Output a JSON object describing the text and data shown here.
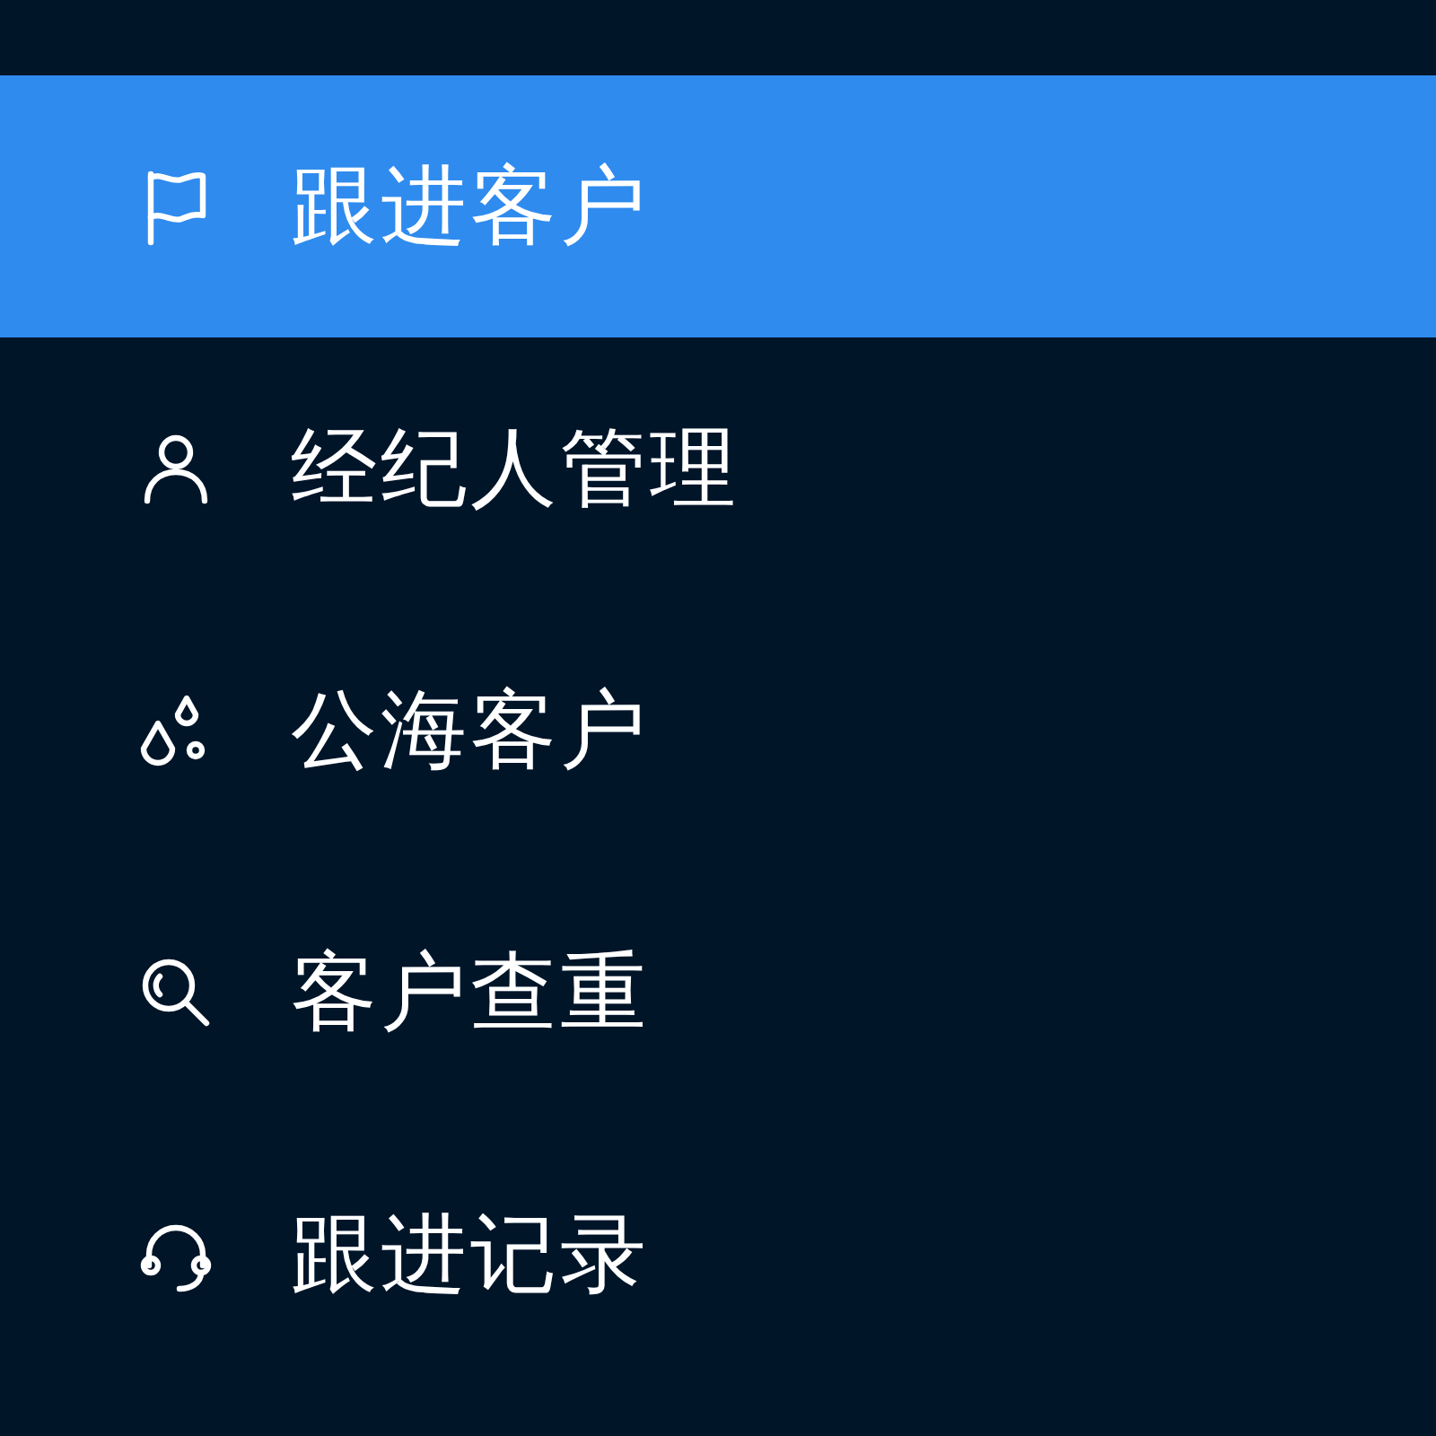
{
  "sidebar": {
    "items": [
      {
        "label": "跟进客户",
        "selected": true
      },
      {
        "label": "经纪人管理",
        "selected": false
      },
      {
        "label": "公海客户",
        "selected": false
      },
      {
        "label": "客户查重",
        "selected": false
      },
      {
        "label": "跟进记录",
        "selected": false
      }
    ]
  }
}
